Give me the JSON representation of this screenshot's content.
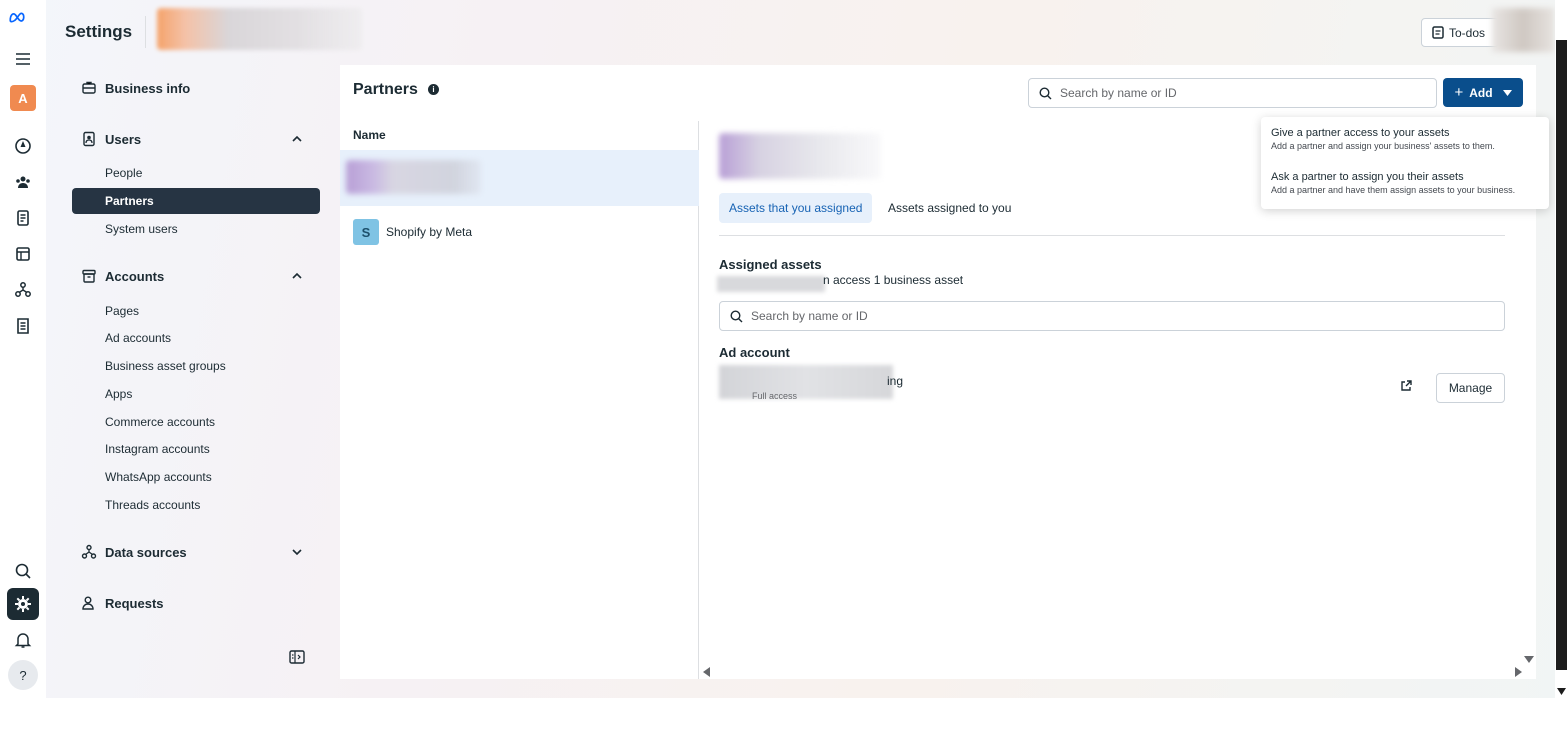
{
  "header": {
    "title": "Settings",
    "todos_label": "To-dos"
  },
  "rail": {
    "icons": [
      "menu-icon",
      "account-icon",
      "compass-icon",
      "people-icon",
      "pages-icon",
      "inventory-icon",
      "integrations-icon",
      "billing-icon",
      "search-icon",
      "settings-icon",
      "notifications-icon",
      "help-icon"
    ],
    "account_letter": "A",
    "help_label": "?"
  },
  "sidebar": {
    "business_info": "Business info",
    "users": {
      "label": "Users",
      "items": [
        {
          "label": "People"
        },
        {
          "label": "Partners",
          "active": true
        },
        {
          "label": "System users"
        }
      ]
    },
    "accounts": {
      "label": "Accounts",
      "items": [
        {
          "label": "Pages"
        },
        {
          "label": "Ad accounts"
        },
        {
          "label": "Business asset groups"
        },
        {
          "label": "Apps"
        },
        {
          "label": "Commerce accounts"
        },
        {
          "label": "Instagram accounts"
        },
        {
          "label": "WhatsApp accounts"
        },
        {
          "label": "Threads accounts"
        }
      ]
    },
    "data_sources": "Data sources",
    "requests": "Requests"
  },
  "main": {
    "title": "Partners",
    "search_placeholder": "Search by name or ID",
    "add_label": "Add",
    "list": {
      "column_header": "Name",
      "rows": [
        {
          "avatar_letter": "S",
          "name": "Shopify by Meta"
        }
      ]
    },
    "detail": {
      "tabs": [
        {
          "label": "Assets that you assigned",
          "active": true
        },
        {
          "label": "Assets assigned to you"
        }
      ],
      "assigned_title": "Assigned assets",
      "access_text": "n access 1 business asset",
      "search_placeholder": "Search by name or ID",
      "ad_account_title": "Ad account",
      "ad_account_suffix": "ing",
      "ad_access_level": "Full access",
      "manage_label": "Manage"
    }
  },
  "add_menu": {
    "items": [
      {
        "title": "Give a partner access to your assets",
        "description": "Add a partner and assign your business' assets to them."
      },
      {
        "title": "Ask a partner to assign you their assets",
        "description": "Add a partner and have them assign assets to your business."
      }
    ]
  },
  "colors": {
    "accent": "#0a4e8c",
    "active_nav": "#263443",
    "selected_row": "#e7f0fb",
    "tab_active_text": "#1763b4"
  }
}
